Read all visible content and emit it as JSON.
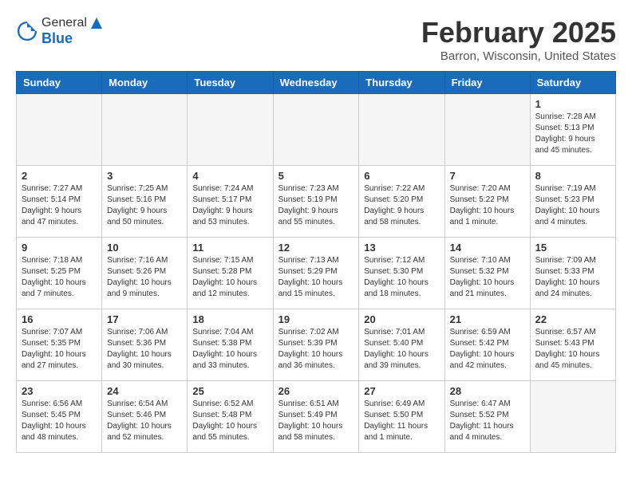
{
  "header": {
    "logo_general": "General",
    "logo_blue": "Blue",
    "title": "February 2025",
    "subtitle": "Barron, Wisconsin, United States"
  },
  "columns": [
    "Sunday",
    "Monday",
    "Tuesday",
    "Wednesday",
    "Thursday",
    "Friday",
    "Saturday"
  ],
  "weeks": [
    [
      {
        "day": "",
        "info": ""
      },
      {
        "day": "",
        "info": ""
      },
      {
        "day": "",
        "info": ""
      },
      {
        "day": "",
        "info": ""
      },
      {
        "day": "",
        "info": ""
      },
      {
        "day": "",
        "info": ""
      },
      {
        "day": "1",
        "info": "Sunrise: 7:28 AM\nSunset: 5:13 PM\nDaylight: 9 hours\nand 45 minutes."
      }
    ],
    [
      {
        "day": "2",
        "info": "Sunrise: 7:27 AM\nSunset: 5:14 PM\nDaylight: 9 hours\nand 47 minutes."
      },
      {
        "day": "3",
        "info": "Sunrise: 7:25 AM\nSunset: 5:16 PM\nDaylight: 9 hours\nand 50 minutes."
      },
      {
        "day": "4",
        "info": "Sunrise: 7:24 AM\nSunset: 5:17 PM\nDaylight: 9 hours\nand 53 minutes."
      },
      {
        "day": "5",
        "info": "Sunrise: 7:23 AM\nSunset: 5:19 PM\nDaylight: 9 hours\nand 55 minutes."
      },
      {
        "day": "6",
        "info": "Sunrise: 7:22 AM\nSunset: 5:20 PM\nDaylight: 9 hours\nand 58 minutes."
      },
      {
        "day": "7",
        "info": "Sunrise: 7:20 AM\nSunset: 5:22 PM\nDaylight: 10 hours\nand 1 minute."
      },
      {
        "day": "8",
        "info": "Sunrise: 7:19 AM\nSunset: 5:23 PM\nDaylight: 10 hours\nand 4 minutes."
      }
    ],
    [
      {
        "day": "9",
        "info": "Sunrise: 7:18 AM\nSunset: 5:25 PM\nDaylight: 10 hours\nand 7 minutes."
      },
      {
        "day": "10",
        "info": "Sunrise: 7:16 AM\nSunset: 5:26 PM\nDaylight: 10 hours\nand 9 minutes."
      },
      {
        "day": "11",
        "info": "Sunrise: 7:15 AM\nSunset: 5:28 PM\nDaylight: 10 hours\nand 12 minutes."
      },
      {
        "day": "12",
        "info": "Sunrise: 7:13 AM\nSunset: 5:29 PM\nDaylight: 10 hours\nand 15 minutes."
      },
      {
        "day": "13",
        "info": "Sunrise: 7:12 AM\nSunset: 5:30 PM\nDaylight: 10 hours\nand 18 minutes."
      },
      {
        "day": "14",
        "info": "Sunrise: 7:10 AM\nSunset: 5:32 PM\nDaylight: 10 hours\nand 21 minutes."
      },
      {
        "day": "15",
        "info": "Sunrise: 7:09 AM\nSunset: 5:33 PM\nDaylight: 10 hours\nand 24 minutes."
      }
    ],
    [
      {
        "day": "16",
        "info": "Sunrise: 7:07 AM\nSunset: 5:35 PM\nDaylight: 10 hours\nand 27 minutes."
      },
      {
        "day": "17",
        "info": "Sunrise: 7:06 AM\nSunset: 5:36 PM\nDaylight: 10 hours\nand 30 minutes."
      },
      {
        "day": "18",
        "info": "Sunrise: 7:04 AM\nSunset: 5:38 PM\nDaylight: 10 hours\nand 33 minutes."
      },
      {
        "day": "19",
        "info": "Sunrise: 7:02 AM\nSunset: 5:39 PM\nDaylight: 10 hours\nand 36 minutes."
      },
      {
        "day": "20",
        "info": "Sunrise: 7:01 AM\nSunset: 5:40 PM\nDaylight: 10 hours\nand 39 minutes."
      },
      {
        "day": "21",
        "info": "Sunrise: 6:59 AM\nSunset: 5:42 PM\nDaylight: 10 hours\nand 42 minutes."
      },
      {
        "day": "22",
        "info": "Sunrise: 6:57 AM\nSunset: 5:43 PM\nDaylight: 10 hours\nand 45 minutes."
      }
    ],
    [
      {
        "day": "23",
        "info": "Sunrise: 6:56 AM\nSunset: 5:45 PM\nDaylight: 10 hours\nand 48 minutes."
      },
      {
        "day": "24",
        "info": "Sunrise: 6:54 AM\nSunset: 5:46 PM\nDaylight: 10 hours\nand 52 minutes."
      },
      {
        "day": "25",
        "info": "Sunrise: 6:52 AM\nSunset: 5:48 PM\nDaylight: 10 hours\nand 55 minutes."
      },
      {
        "day": "26",
        "info": "Sunrise: 6:51 AM\nSunset: 5:49 PM\nDaylight: 10 hours\nand 58 minutes."
      },
      {
        "day": "27",
        "info": "Sunrise: 6:49 AM\nSunset: 5:50 PM\nDaylight: 11 hours\nand 1 minute."
      },
      {
        "day": "28",
        "info": "Sunrise: 6:47 AM\nSunset: 5:52 PM\nDaylight: 11 hours\nand 4 minutes."
      },
      {
        "day": "",
        "info": ""
      }
    ]
  ]
}
